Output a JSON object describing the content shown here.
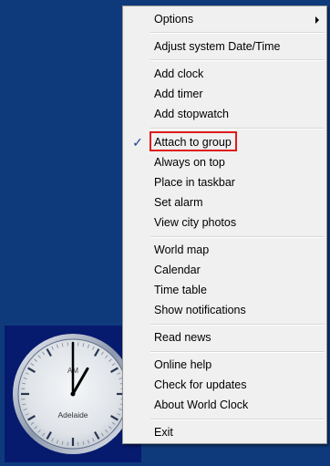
{
  "menu": {
    "items": [
      {
        "label": "Options"
      },
      {
        "label": "Adjust system Date/Time"
      },
      {
        "label": "Add clock"
      },
      {
        "label": "Add timer"
      },
      {
        "label": "Add stopwatch"
      },
      {
        "label": "Attach to group",
        "checked": true
      },
      {
        "label": "Always on top"
      },
      {
        "label": "Place in taskbar"
      },
      {
        "label": "Set alarm"
      },
      {
        "label": "View city photos"
      },
      {
        "label": "World map"
      },
      {
        "label": "Calendar"
      },
      {
        "label": "Time table"
      },
      {
        "label": "Show notifications"
      },
      {
        "label": "Read news"
      },
      {
        "label": "Online help"
      },
      {
        "label": "Check for updates"
      },
      {
        "label": "About World Clock"
      },
      {
        "label": "Exit"
      }
    ],
    "check_glyph": "✓"
  },
  "clock": {
    "city": "Adelaide",
    "period": "AM",
    "hour": 1,
    "minute": 0
  },
  "colors": {
    "desktop": "#0e3a7c",
    "widget_bg": "#061a6e",
    "menu_bg": "#f0f0f0",
    "highlight": "#e01a1a",
    "check": "#1c3f91"
  }
}
